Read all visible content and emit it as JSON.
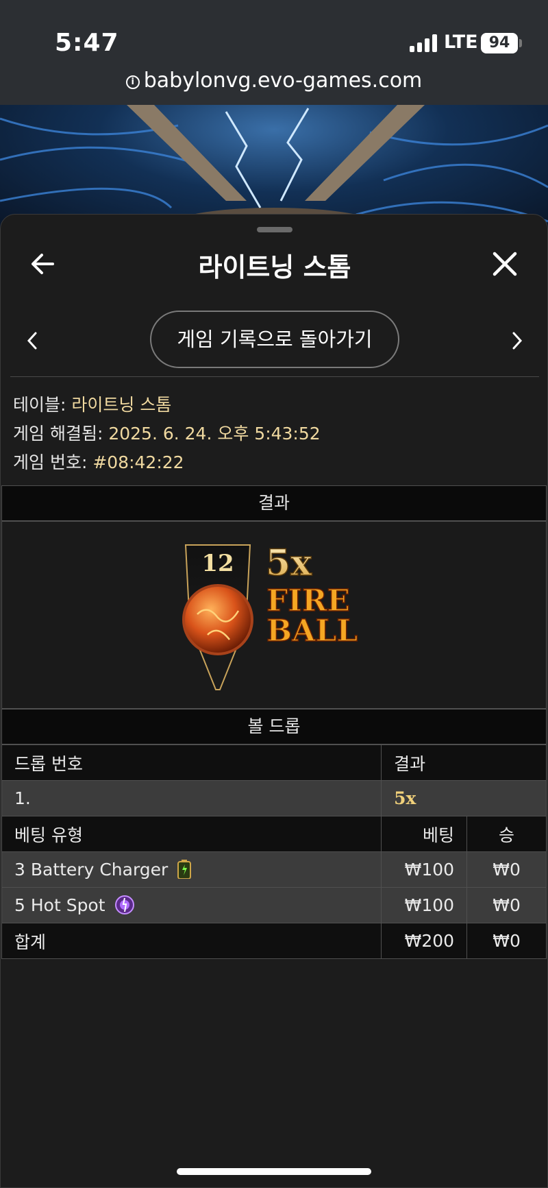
{
  "status": {
    "time": "5:47",
    "network": "LTE",
    "battery": "94"
  },
  "browser": {
    "url": "babylonvg.evo-games.com"
  },
  "header": {
    "title": "라이트닝 스톰",
    "back_to_history": "게임 기록으로 돌아가기"
  },
  "meta": {
    "table_label": "테이블:",
    "table_value": "라이트닝 스톰",
    "resolved_label": "게임 해결됨:",
    "resolved_value": "2025. 6. 24. 오후 5:43:52",
    "game_no_label": "게임 번호:",
    "game_no_value": "#08:42:22"
  },
  "result": {
    "heading": "결과",
    "number": "12",
    "multiplier": "5x",
    "fireball_line1": "FIRE",
    "fireball_line2": "BALL"
  },
  "ball_drop": {
    "heading": "볼 드롭",
    "col_drop_no": "드롭 번호",
    "col_result": "결과",
    "rows": [
      {
        "drop": "1.",
        "result": "5x"
      }
    ]
  },
  "bets": {
    "col_type": "베팅 유형",
    "col_bet": "베팅",
    "col_win": "승",
    "rows": [
      {
        "type": "3 Battery Charger",
        "bet": "₩100",
        "win": "₩0",
        "icon": "battery-icon"
      },
      {
        "type": "5 Hot Spot",
        "bet": "₩100",
        "win": "₩0",
        "icon": "hot-spot-icon"
      }
    ],
    "total_label": "합계",
    "total_bet": "₩200",
    "total_win": "₩0"
  },
  "colors": {
    "gold": "#f0d9a0",
    "fire": "#e2671d"
  }
}
